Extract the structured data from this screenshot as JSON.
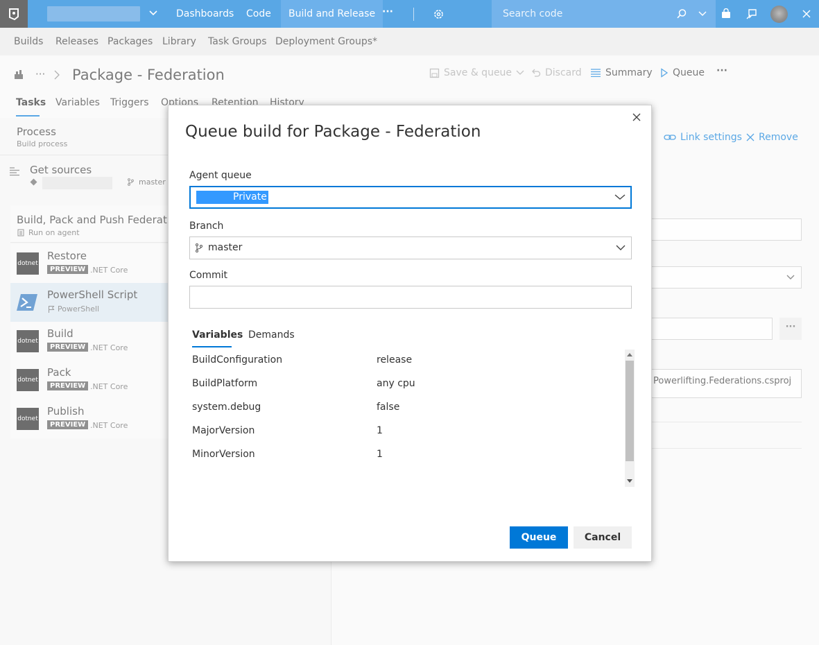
{
  "topbar": {
    "nav": [
      "Dashboards",
      "Code",
      "Build and Release"
    ],
    "more": "···",
    "search_placeholder": "Search code"
  },
  "hub": {
    "items": [
      "Builds",
      "Releases",
      "Packages",
      "Library",
      "Task Groups",
      "Deployment Groups*"
    ]
  },
  "header": {
    "breadcrumb_more": "···",
    "title": "Package - Federation",
    "commands": {
      "save_queue": "Save & queue",
      "discard": "Discard",
      "summary": "Summary",
      "queue": "Queue",
      "more": "···"
    },
    "tabs": [
      "Tasks",
      "Variables",
      "Triggers",
      "Options",
      "Retention",
      "History"
    ]
  },
  "process": {
    "title": "Process",
    "subtitle": "Build process",
    "get_sources": "Get sources",
    "branch": "master",
    "phase_title": "Build, Pack and Push Federation",
    "phase_sub": "Run on agent",
    "tasks": [
      {
        "name": "Restore",
        "badge": "PREVIEW",
        "sub": ".NET Core",
        "icon": "dotnet"
      },
      {
        "name": "PowerShell Script",
        "badge": "",
        "sub": "PowerShell",
        "icon": "powershell"
      },
      {
        "name": "Build",
        "badge": "PREVIEW",
        "sub": ".NET Core",
        "icon": "dotnet"
      },
      {
        "name": "Pack",
        "badge": "PREVIEW",
        "sub": ".NET Core",
        "icon": "dotnet"
      },
      {
        "name": "Publish",
        "badge": "PREVIEW",
        "sub": ".NET Core",
        "icon": "dotnet"
      }
    ]
  },
  "right": {
    "link_settings": "Link settings",
    "remove": "Remove",
    "project_path": "Powerlifting.Federations.csproj",
    "more": "···"
  },
  "dialog": {
    "title": "Queue build for Package - Federation",
    "agent_queue_label": "Agent queue",
    "agent_queue_value": "Private",
    "branch_label": "Branch",
    "branch_value": "master",
    "commit_label": "Commit",
    "commit_value": "",
    "tabs": [
      "Variables",
      "Demands"
    ],
    "variables": [
      {
        "name": "BuildConfiguration",
        "value": "release"
      },
      {
        "name": "BuildPlatform",
        "value": "any cpu"
      },
      {
        "name": "system.debug",
        "value": "false"
      },
      {
        "name": "MajorVersion",
        "value": "1"
      },
      {
        "name": "MinorVersion",
        "value": "1"
      }
    ],
    "queue_button": "Queue",
    "cancel_button": "Cancel"
  },
  "colors": {
    "accent": "#0078d7",
    "topbar": "#0078d7",
    "selected_task": "#dae6f0"
  }
}
